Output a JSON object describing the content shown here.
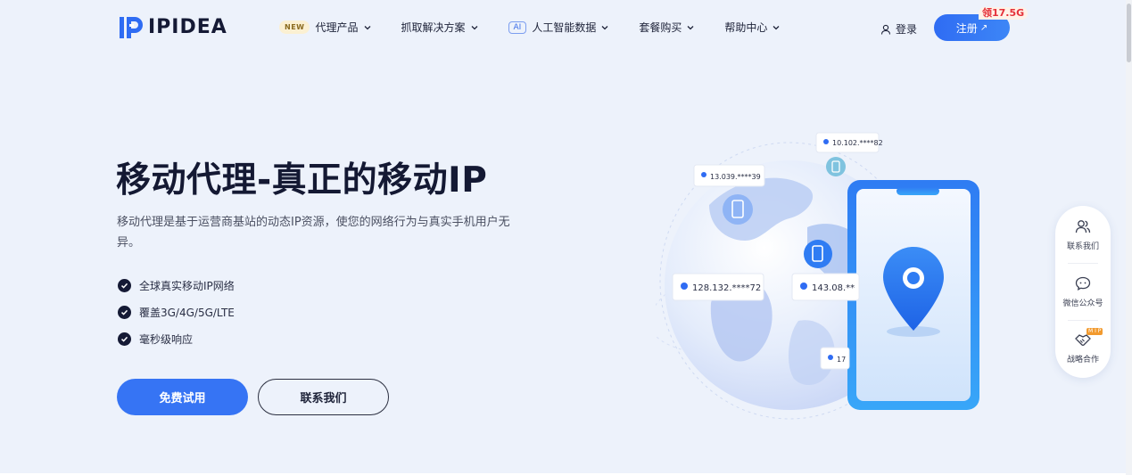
{
  "header": {
    "logo_text": "IPIDEA",
    "nav": [
      {
        "badge": "NEW",
        "label": "代理产品"
      },
      {
        "label": "抓取解决方案"
      },
      {
        "badge": "AI",
        "label": "人工智能数据"
      },
      {
        "label": "套餐购买"
      },
      {
        "label": "帮助中心"
      }
    ],
    "login_label": "登录",
    "register_label": "注册",
    "register_arrow": "↗",
    "promo_label": "领17.5G"
  },
  "hero": {
    "title": "移动代理-真正的移动IP",
    "description": "移动代理是基于运营商基站的动态IP资源，使您的网络行为与真实手机用户无异。",
    "features": [
      "全球真实移动IP网络",
      "覆盖3G/4G/5G/LTE",
      "毫秒级响应"
    ],
    "primary_button": "免费试用",
    "secondary_button": "联系我们"
  },
  "illustration": {
    "ip_labels": [
      "10.102.****82",
      "13.039.****39",
      "128.132.****72",
      "143.08.**",
      "17"
    ]
  },
  "float_panel": {
    "items": [
      {
        "label": "联系我们",
        "icon": "users-icon"
      },
      {
        "label": "微信公众号",
        "icon": "wechat-icon"
      },
      {
        "label": "战略合作",
        "icon": "handshake-icon",
        "badge": "M I P"
      }
    ]
  },
  "colors": {
    "brand": "#3674f4",
    "background": "#edf2fb",
    "title": "#141933",
    "promo": "#e5313a"
  }
}
